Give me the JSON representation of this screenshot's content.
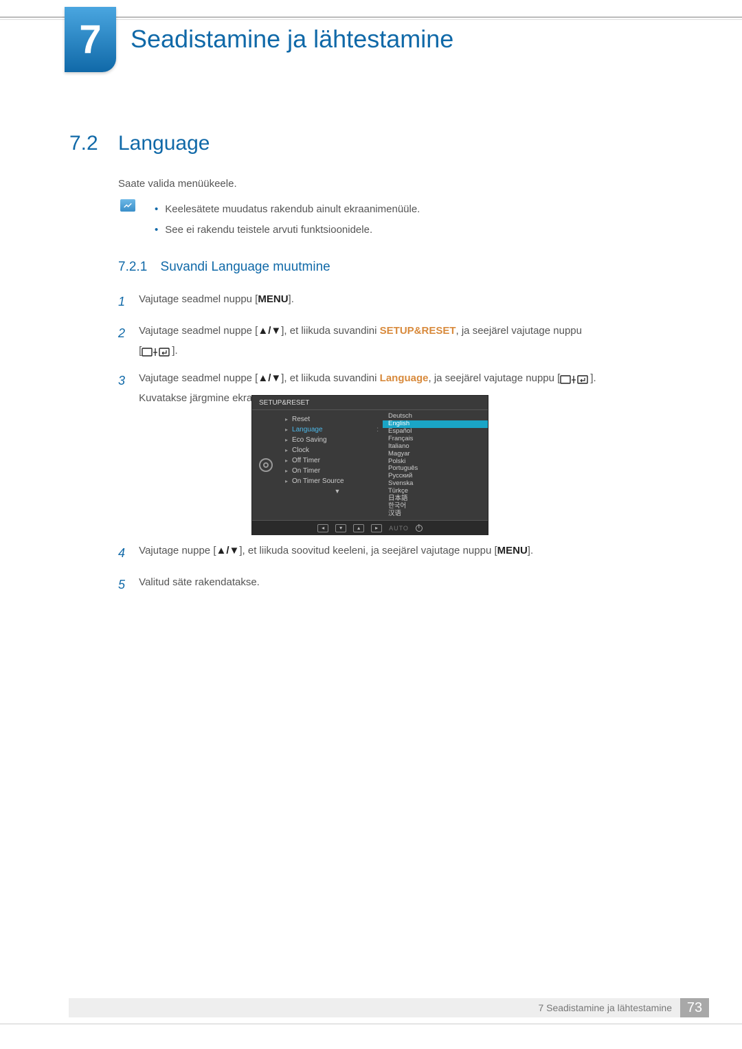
{
  "chapter": {
    "number": "7",
    "title": "Seadistamine ja lähtestamine"
  },
  "section": {
    "number": "7.2",
    "title": "Language"
  },
  "intro": "Saate valida menüükeele.",
  "notes": {
    "items": [
      "Keelesätete muudatus rakendub ainult ekraanimenüüle.",
      "See ei rakendu teistele arvuti funktsioonidele."
    ]
  },
  "subsection": {
    "number": "7.2.1",
    "title": "Suvandi Language muutmine"
  },
  "steps": {
    "s1": {
      "num": "1",
      "pre": "Vajutage seadmel nuppu [",
      "menu": "MENU",
      "post": "]."
    },
    "s2": {
      "num": "2",
      "pre": "Vajutage seadmel nuppe [",
      "arrows": "▲/▼",
      "mid": "], et liikuda suvandini ",
      "kw": "SETUP&RESET",
      "post": ", ja seejärel vajutage nuppu",
      "line2pre": "[",
      "line2post": "]."
    },
    "s3": {
      "num": "3",
      "pre": "Vajutage seadmel nuppe [",
      "arrows": "▲/▼",
      "mid": "], et liikuda suvandini ",
      "kw": "Language",
      "post": ", ja seejärel vajutage nuppu [",
      "post2": "].",
      "line2": "Kuvatakse järgmine ekraan."
    },
    "s4": {
      "num": "4",
      "pre": "Vajutage nuppe [",
      "arrows": "▲/▼",
      "mid": "], et liikuda soovitud keeleni, ja seejärel vajutage nuppu [",
      "menu": "MENU",
      "post": "]."
    },
    "s5": {
      "num": "5",
      "text": "Valitud säte rakendatakse."
    }
  },
  "osd": {
    "title": "SETUP&RESET",
    "left_items": [
      "Reset",
      "Language",
      "Eco Saving",
      "Clock",
      "Off Timer",
      "On Timer",
      "On Timer Source"
    ],
    "selected_left": "Language",
    "languages": [
      "Deutsch",
      "English",
      "Español",
      "Français",
      "Italiano",
      "Magyar",
      "Polski",
      "Português",
      "Русский",
      "Svenska",
      "Türkçe",
      "日本語",
      "한국어",
      "汉语"
    ],
    "selected_lang": "English",
    "footer_auto": "AUTO"
  },
  "footer": {
    "text": "7 Seadistamine ja lähtestamine",
    "page": "73"
  }
}
